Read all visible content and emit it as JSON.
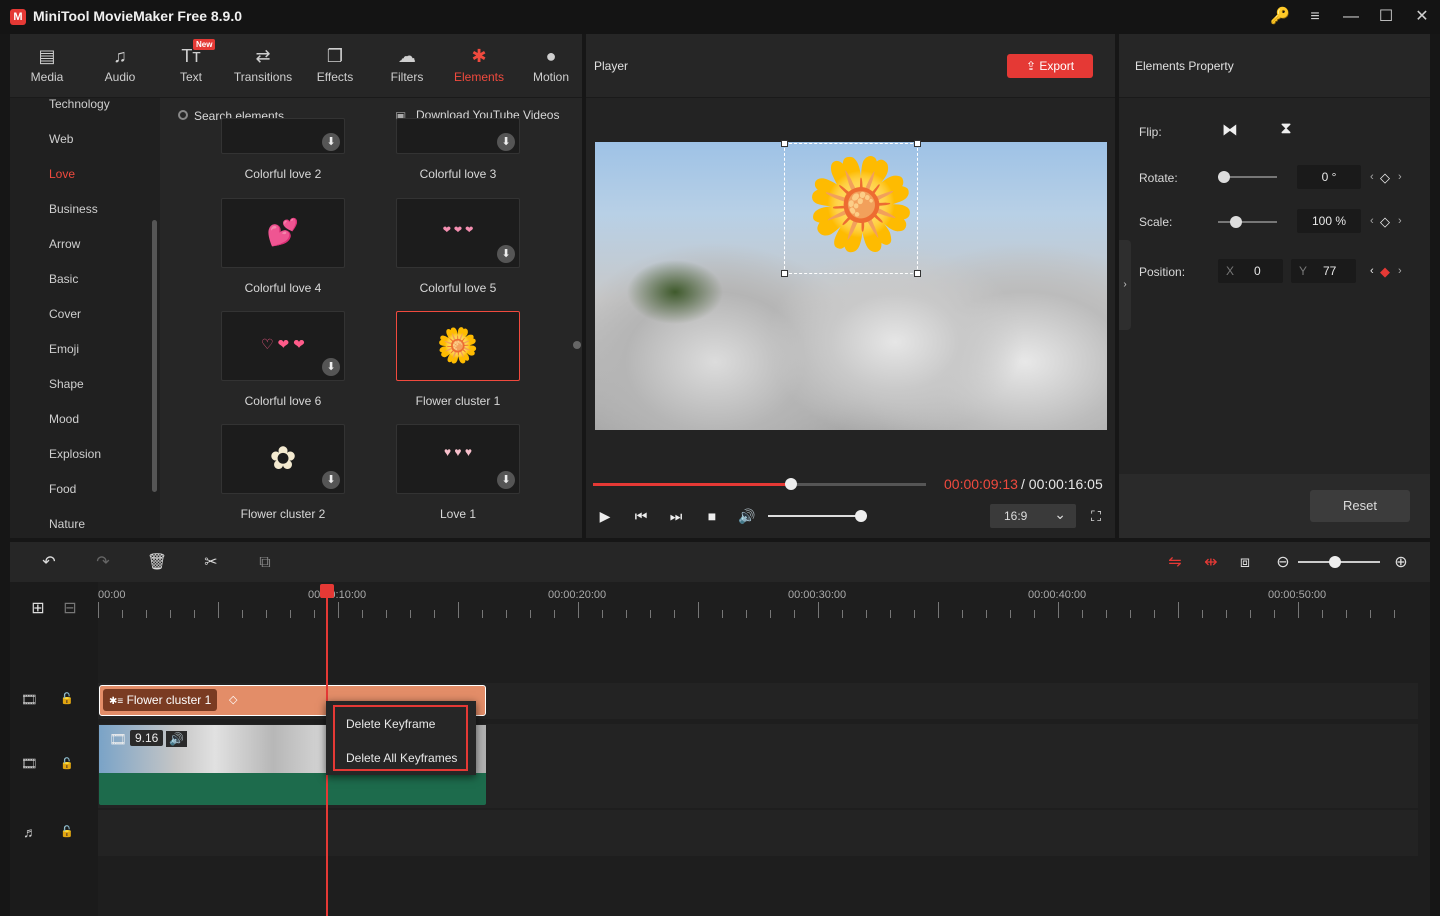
{
  "window": {
    "title": "MiniTool MovieMaker Free 8.9.0",
    "logo_text": "M",
    "controls": [
      "🔑",
      "≡",
      "—",
      "☐",
      "✕"
    ]
  },
  "toolbar": {
    "tabs": [
      {
        "label": "Media",
        "icon": "▤"
      },
      {
        "label": "Audio",
        "icon": "♫"
      },
      {
        "label": "Text",
        "icon": "Tт"
      },
      {
        "label": "Transitions",
        "icon": "⇄"
      },
      {
        "label": "Effects",
        "icon": "❐"
      },
      {
        "label": "Filters",
        "icon": "☁"
      },
      {
        "label": "Elements",
        "icon": "✱"
      },
      {
        "label": "Motion",
        "icon": "●"
      }
    ],
    "new_badge": "New",
    "active": "Elements"
  },
  "categories": {
    "items": [
      "Technology",
      "Web",
      "Love",
      "Business",
      "Arrow",
      "Basic",
      "Cover",
      "Emoji",
      "Shape",
      "Mood",
      "Explosion",
      "Food",
      "Nature"
    ],
    "active": "Love"
  },
  "elements": {
    "search_placeholder": "Search elements",
    "download_youtube": "Download YouTube Videos",
    "items": [
      {
        "label": "Colorful love 2",
        "glyph": "",
        "download": true
      },
      {
        "label": "Colorful love 3",
        "glyph": "",
        "download": true
      },
      {
        "label": "Colorful love 4",
        "glyph": "💕",
        "download": false
      },
      {
        "label": "Colorful love 5",
        "glyph": "❤ ❤ ❤",
        "download": true
      },
      {
        "label": "Colorful love 6",
        "glyph": "♡ ❤ ❤",
        "download": true
      },
      {
        "label": "Flower cluster 1",
        "glyph": "🌼",
        "download": false
      },
      {
        "label": "Flower cluster 2",
        "glyph": "✿",
        "download": true
      },
      {
        "label": "Love 1",
        "glyph": "♥ ♥ ♥",
        "download": true
      }
    ],
    "download_glyph": "⬇",
    "selected": "Flower cluster 1"
  },
  "player": {
    "title": "Player",
    "export_label": "Export",
    "time_current": "00:00:09:13",
    "time_total": "/ 00:00:16:05",
    "progress": 0.594,
    "volume": 0.95,
    "aspect_ratio": "16:9",
    "overlay_glyph": "🌼",
    "buttons": {
      "play": "▶",
      "prev": "⏮",
      "next": "⏭",
      "stop": "■",
      "volume": "🔊",
      "fullscreen": "⛶",
      "ratio_caret": "⌄"
    }
  },
  "properties": {
    "title": "Elements Property",
    "flip_label": "Flip:",
    "flip_h": "⧓",
    "flip_v": "⧗",
    "rotate_label": "Rotate:",
    "rotate_value": "0 °",
    "rotate_level": 0.0,
    "scale_label": "Scale:",
    "scale_value": "100 %",
    "scale_level": 0.3,
    "position_label": "Position:",
    "x_label": "X",
    "x_value": "0",
    "y_label": "Y",
    "y_value": "77",
    "kf_prev": "‹",
    "kf_next": "›",
    "kf_diamond": "◇",
    "kf_active": "◆",
    "collapse": "›",
    "reset_label": "Reset"
  },
  "timeline": {
    "tools": {
      "undo": "↶",
      "redo": "↷",
      "delete": "🗑",
      "split": "✂",
      "crop": "⧉",
      "add_track": "⊞",
      "remove_track": "⊟"
    },
    "right_tools": [
      "⇋",
      "⇹",
      "⧈"
    ],
    "zoom_out": "⊖",
    "zoom_in": "⊕",
    "zoom_level": 0.45,
    "ruler": [
      "00:00",
      "00:00:10:00",
      "00:00:20:00",
      "00:00:30:00",
      "00:00:40:00",
      "00:00:50:00"
    ],
    "element_clip": "Flower cluster 1",
    "element_clip_icon": "✱≡",
    "video_duration": "9.16",
    "video_icons": [
      "🎞",
      "🔊"
    ],
    "track_icons": {
      "film": "🎞",
      "lock": "🔓",
      "music": "♬"
    },
    "keyframe": "◇",
    "context_menu": [
      "Delete Keyframe",
      "Delete All Keyframes"
    ]
  }
}
